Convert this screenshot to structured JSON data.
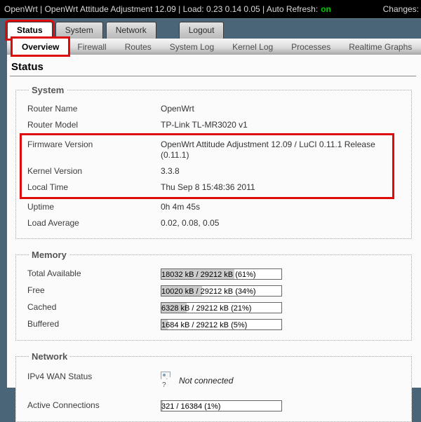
{
  "topbar": {
    "left_text": "OpenWrt | OpenWrt Attitude Adjustment 12.09 | Load: 0.23 0.14 0.05 | Auto Refresh:",
    "auto_refresh_state": "on",
    "changes_label": "Changes:"
  },
  "nav": {
    "main_tabs": [
      {
        "label": "Status"
      },
      {
        "label": "System"
      },
      {
        "label": "Network"
      },
      {
        "label": "Logout"
      }
    ],
    "sub_tabs": [
      {
        "label": "Overview"
      },
      {
        "label": "Firewall"
      },
      {
        "label": "Routes"
      },
      {
        "label": "System Log"
      },
      {
        "label": "Kernel Log"
      },
      {
        "label": "Processes"
      },
      {
        "label": "Realtime Graphs"
      }
    ]
  },
  "page": {
    "title": "Status"
  },
  "system": {
    "legend": "System",
    "rows": [
      {
        "label": "Router Name",
        "value": "OpenWrt"
      },
      {
        "label": "Router Model",
        "value": "TP-Link TL-MR3020 v1"
      },
      {
        "label": "Firmware Version",
        "value": "OpenWrt Attitude Adjustment 12.09 / LuCI 0.11.1 Release (0.11.1)"
      },
      {
        "label": "Kernel Version",
        "value": "3.3.8"
      },
      {
        "label": "Local Time",
        "value": "Thu Sep 8 15:48:36 2011"
      },
      {
        "label": "Uptime",
        "value": "0h 4m 45s"
      },
      {
        "label": "Load Average",
        "value": "0.02, 0.08, 0.05"
      }
    ]
  },
  "memory": {
    "legend": "Memory",
    "rows": [
      {
        "label": "Total Available",
        "text": "18032 kB / 29212 kB (61%)",
        "percent": 61
      },
      {
        "label": "Free",
        "text": "10020 kB / 29212 kB (34%)",
        "percent": 34
      },
      {
        "label": "Cached",
        "text": "6328 kB / 29212 kB (21%)",
        "percent": 21
      },
      {
        "label": "Buffered",
        "text": "1684 kB / 29212 kB (5%)",
        "percent": 5
      }
    ]
  },
  "network": {
    "legend": "Network",
    "wan_label": "IPv4 WAN Status",
    "wan_status": "Not connected",
    "wan_icon_alt": "?",
    "connections_label": "Active Connections",
    "connections_text": "321 / 16384 (1%)",
    "connections_percent": 1
  },
  "colors": {
    "annotation_red": "#dd0b0b",
    "topbar_bg": "#000000",
    "navbar_bg": "#4a6577",
    "auto_refresh_on": "#00cc00",
    "bar_fill": "#cccccc"
  }
}
